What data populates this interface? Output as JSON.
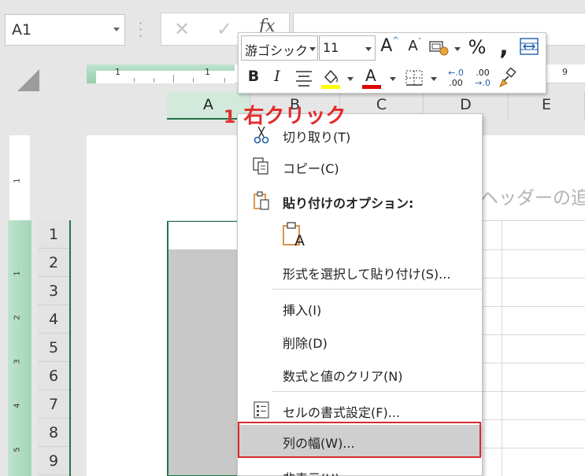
{
  "formula_bar": {
    "name_box": "A1",
    "cancel_icon": "✕",
    "enter_icon": "✓",
    "fx_label": "fx"
  },
  "ruler": {
    "top_labels": [
      "1",
      "1",
      "9"
    ],
    "left_labels": [
      "1",
      "1",
      "2",
      "3",
      "4",
      "5"
    ]
  },
  "columns": [
    "A",
    "B",
    "C",
    "D",
    "E"
  ],
  "rows": [
    "1",
    "2",
    "3",
    "4",
    "5",
    "6",
    "7",
    "8",
    "9"
  ],
  "page_header_hint": "ヘッダーの追",
  "mini_toolbar": {
    "font_name": "游ゴシック",
    "font_size": "11",
    "grow_font": "A",
    "shrink_font": "A",
    "percent": "%",
    "comma": ",",
    "bold": "B",
    "italic": "I",
    "font_color_letter": "A",
    "dec_increase_top": "←.0",
    "dec_increase_bottom": ".00",
    "dec_decrease_top": ".00",
    "dec_decrease_bottom": "→.0",
    "fill_color": "#ffff00",
    "font_color": "#e00000"
  },
  "context_menu": {
    "items": [
      {
        "label": "切り取り(T)"
      },
      {
        "label": "コピー(C)"
      },
      {
        "label": "貼り付けのオプション:"
      },
      {
        "label": "A"
      },
      {
        "label": "形式を選択して貼り付け(S)..."
      },
      {
        "label": "挿入(I)"
      },
      {
        "label": "削除(D)"
      },
      {
        "label": "数式と値のクリア(N)"
      },
      {
        "label": "セルの書式設定(F)..."
      },
      {
        "label": "列の幅(W)..."
      },
      {
        "label": "非表示(H)"
      }
    ]
  },
  "annotation": {
    "number": "1",
    "text": "右クリック",
    "color": "#e22c2c"
  },
  "colors": {
    "accent_green": "#217346",
    "highlight_red": "#d52b2b"
  }
}
